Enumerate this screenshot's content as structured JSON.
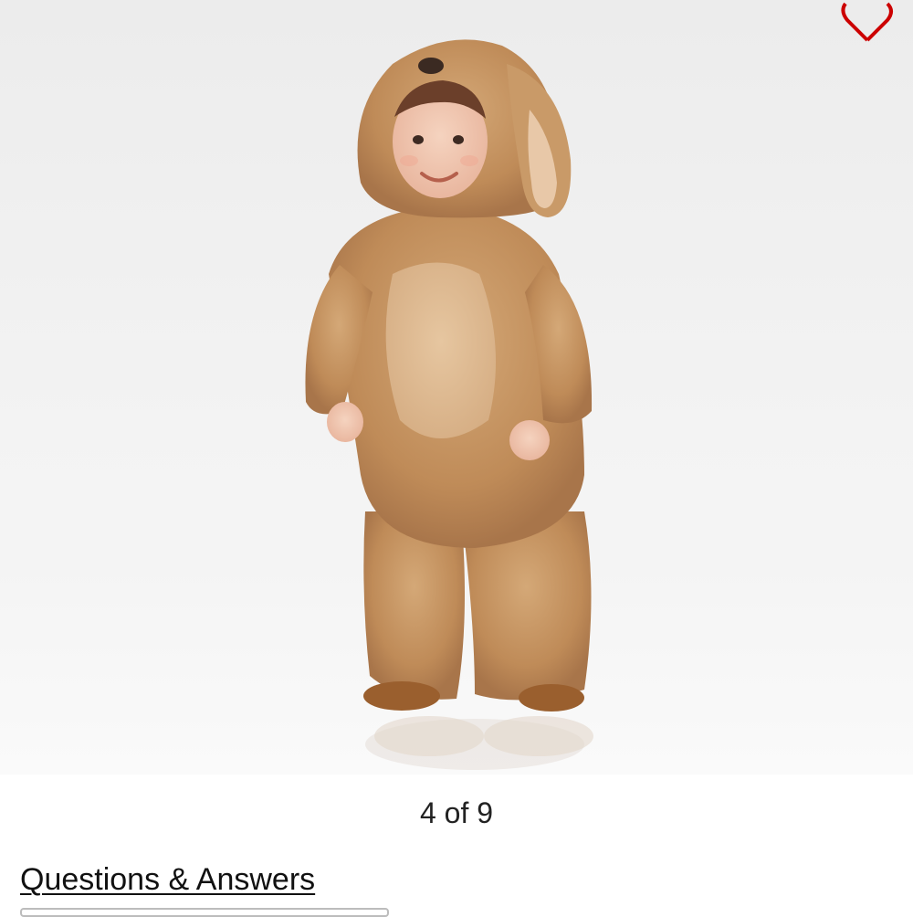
{
  "gallery": {
    "image_alt": "Toddler wearing plush golden puppy costume",
    "position": {
      "current": 4,
      "total": 9
    },
    "counter_text": "4 of 9",
    "favorite_icon": "heart-outline-icon",
    "favorite_color": "#cc0000"
  },
  "questions": {
    "heading": "Questions & Answers"
  }
}
